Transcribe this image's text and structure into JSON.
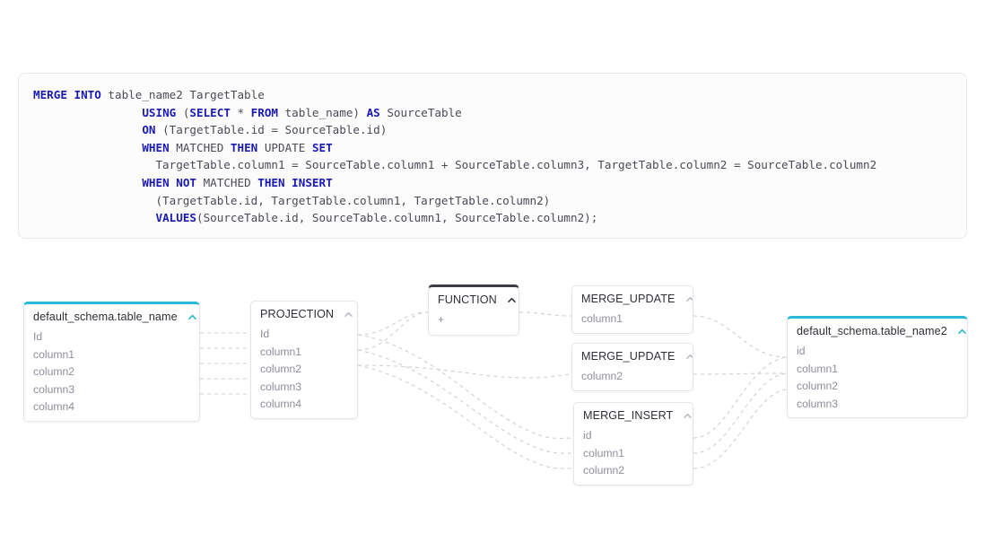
{
  "code_panel": {
    "language": "sql",
    "lines": [
      [
        {
          "t": "MERGE INTO",
          "k": true
        },
        {
          "t": " table_name2 TargetTable",
          "k": false
        }
      ],
      [
        {
          "t": "                ",
          "k": false
        },
        {
          "t": "USING",
          "k": true
        },
        {
          "t": " (",
          "k": false
        },
        {
          "t": "SELECT",
          "k": true
        },
        {
          "t": " * ",
          "k": false
        },
        {
          "t": "FROM",
          "k": true
        },
        {
          "t": " table_name) ",
          "k": false
        },
        {
          "t": "AS",
          "k": true
        },
        {
          "t": " SourceTable",
          "k": false
        }
      ],
      [
        {
          "t": "                ",
          "k": false
        },
        {
          "t": "ON",
          "k": true
        },
        {
          "t": " (TargetTable.id = SourceTable.id)",
          "k": false
        }
      ],
      [
        {
          "t": "                ",
          "k": false
        },
        {
          "t": "WHEN",
          "k": true
        },
        {
          "t": " MATCHED ",
          "k": false
        },
        {
          "t": "THEN",
          "k": true
        },
        {
          "t": " UPDATE ",
          "k": false
        },
        {
          "t": "SET",
          "k": true
        }
      ],
      [
        {
          "t": "                  TargetTable.column1 = SourceTable.column1 + SourceTable.column3, TargetTable.column2 = SourceTable.column2",
          "k": false
        }
      ],
      [
        {
          "t": "                ",
          "k": false
        },
        {
          "t": "WHEN NOT",
          "k": true
        },
        {
          "t": " MATCHED ",
          "k": false
        },
        {
          "t": "THEN INSERT",
          "k": true
        }
      ],
      [
        {
          "t": "                  (TargetTable.id, TargetTable.column1, TargetTable.column2)",
          "k": false
        }
      ],
      [
        {
          "t": "                  ",
          "k": false
        },
        {
          "t": "VALUES",
          "k": true
        },
        {
          "t": "(SourceTable.id, SourceTable.column1, SourceTable.column2);",
          "k": false
        }
      ]
    ]
  },
  "colors": {
    "accent_teal": "#29b9d4",
    "accent_dark": "#3d3d45",
    "keyword_blue": "#1a1ab5",
    "code_text": "#4a4a55",
    "field_text": "#8e8e9b",
    "edge_gray": "#cfcfd6",
    "node_border": "#e4e4ea",
    "panel_bg": "#fcfcfd"
  },
  "graph": {
    "nodes": {
      "source_table": {
        "title": "default_schema.table_name",
        "chevron": "chevron-up-icon",
        "accent": "teal",
        "fields": [
          "Id",
          "column1",
          "column2",
          "column3",
          "column4"
        ]
      },
      "projection": {
        "title": "PROJECTION",
        "chevron": "chevron-up-icon",
        "accent": "none",
        "fields": [
          "Id",
          "column1",
          "column2",
          "column3",
          "column4"
        ]
      },
      "function": {
        "title": "FUNCTION",
        "chevron": "chevron-up-icon",
        "accent": "dark",
        "fields": [
          "+"
        ]
      },
      "merge_update_1": {
        "title": "MERGE_UPDATE",
        "chevron": "chevron-up-icon",
        "accent": "none",
        "fields": [
          "column1"
        ]
      },
      "merge_update_2": {
        "title": "MERGE_UPDATE",
        "chevron": "chevron-up-icon",
        "accent": "none",
        "fields": [
          "column2"
        ]
      },
      "merge_insert": {
        "title": "MERGE_INSERT",
        "chevron": "chevron-up-icon",
        "accent": "none",
        "fields": [
          "id",
          "column1",
          "column2"
        ]
      },
      "target_table": {
        "title": "default_schema.table_name2",
        "chevron": "chevron-up-icon",
        "accent": "teal",
        "fields": [
          "id",
          "column1",
          "column2",
          "column3"
        ]
      }
    }
  }
}
